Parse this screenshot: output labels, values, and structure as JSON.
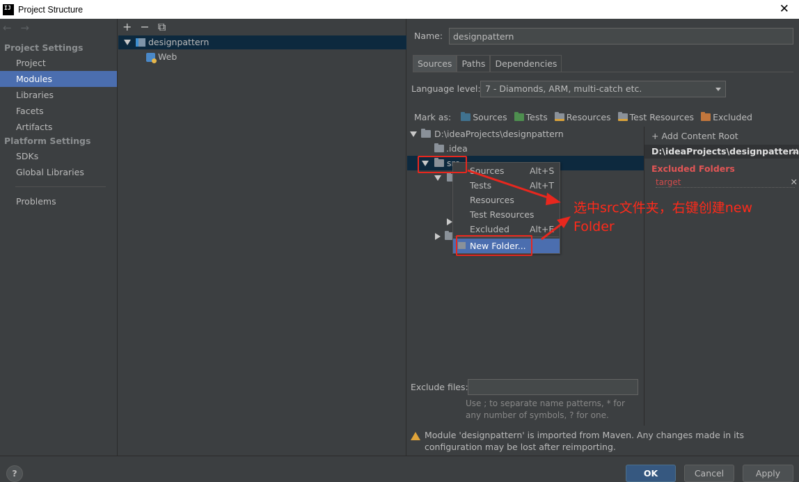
{
  "window": {
    "title": "Project Structure",
    "app_icon": "IJ"
  },
  "nav": {
    "back": "←",
    "forward": "→",
    "project_settings": "Project Settings",
    "project_items": [
      "Project",
      "Modules",
      "Libraries",
      "Facets",
      "Artifacts"
    ],
    "platform_settings": "Platform Settings",
    "platform_items": [
      "SDKs",
      "Global Libraries"
    ],
    "problems": "Problems",
    "selected": "Modules"
  },
  "modules": {
    "toolbar": [
      "+",
      "−",
      "⧉"
    ],
    "root": "designpattern",
    "child": "Web"
  },
  "detail": {
    "name_label": "Name:",
    "name_value": "designpattern",
    "tabs": [
      "Sources",
      "Paths",
      "Dependencies"
    ],
    "active_tab": "Sources",
    "language_label": "Language level:",
    "language_value": "7 - Diamonds, ARM, multi-catch etc.",
    "mark_as_label": "Mark as:",
    "mark_as": [
      "Sources",
      "Tests",
      "Resources",
      "Test Resources",
      "Excluded"
    ],
    "tree": {
      "root": "D:\\ideaProjects\\designpattern",
      "idea": ".idea",
      "src": "src"
    },
    "add_content_root": "+ Add Content Root",
    "content_root": "D:\\ideaProjects\\designpattern",
    "excluded_title": "Excluded Folders",
    "excluded_item": "target",
    "exclude_files_label": "Exclude files:",
    "exclude_hint": "Use ; to separate name patterns, * for any number of symbols, ? for one.",
    "warning": "Module 'designpattern' is imported from Maven. Any changes made in its configuration may be lost after reimporting."
  },
  "context_menu": {
    "items": [
      {
        "label": "Sources",
        "shortcut": "Alt+S"
      },
      {
        "label": "Tests",
        "shortcut": "Alt+T"
      },
      {
        "label": "Resources",
        "shortcut": ""
      },
      {
        "label": "Test Resources",
        "shortcut": ""
      },
      {
        "label": "Excluded",
        "shortcut": "Alt+E"
      }
    ],
    "new_folder": "New Folder..."
  },
  "annotation": {
    "line1": "选中src文件夹，右键创建new",
    "line2": "Folder",
    "color": "#ff2a1a"
  },
  "buttons": {
    "help": "?",
    "ok": "OK",
    "cancel": "Cancel",
    "apply": "Apply"
  },
  "colors": {
    "selection": "#4b6eaf",
    "background": "#3c3f41",
    "excluded": "#e05555"
  }
}
